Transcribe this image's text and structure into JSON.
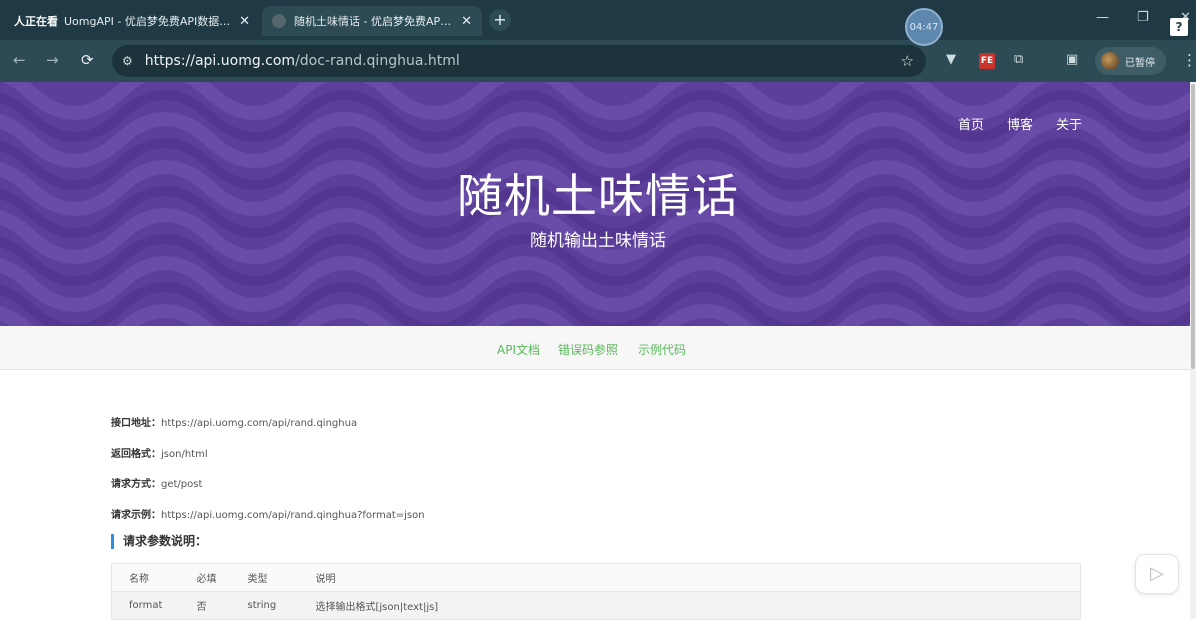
{
  "browser": {
    "tabs": [
      {
        "live": "人正在看",
        "title": "UomgAPI - 优启梦免费API数据接口调用服务平台",
        "close": "✕"
      },
      {
        "title": "随机土味情话 - 优启梦免费API数据接口调用服务平台",
        "close": "✕"
      }
    ],
    "new_tab": "+",
    "timer": "04:47",
    "url_host": "https://api.uomg.com",
    "url_path": "/doc-rand.qinghua.html",
    "profile_label": "已暂停",
    "ext_fe": "FE"
  },
  "hero": {
    "nav": [
      "首页",
      "博客",
      "关于"
    ],
    "title": "随机土味情话",
    "subtitle": "随机输出土味情话"
  },
  "subnav": [
    "API文档",
    "错误码参照",
    "示例代码"
  ],
  "info": [
    {
      "key": "接口地址：",
      "value": "https://api.uomg.com/api/rand.qinghua"
    },
    {
      "key": "返回格式：",
      "value": "json/html"
    },
    {
      "key": "请求方式：",
      "value": "get/post"
    },
    {
      "key": "请求示例：",
      "value": "https://api.uomg.com/api/rand.qinghua?format=json"
    }
  ],
  "params": {
    "heading": "请求参数说明：",
    "columns": [
      "名称",
      "必填",
      "类型",
      "说明"
    ],
    "rows": [
      [
        "format",
        "否",
        "string",
        "选择输出格式[json|text|js]"
      ]
    ]
  },
  "colors": {
    "hero_bg": "#5b3f9a",
    "link_green": "#5cb85c",
    "accent_blue": "#2f8fd8",
    "browser_dark": "#1f3a44"
  }
}
